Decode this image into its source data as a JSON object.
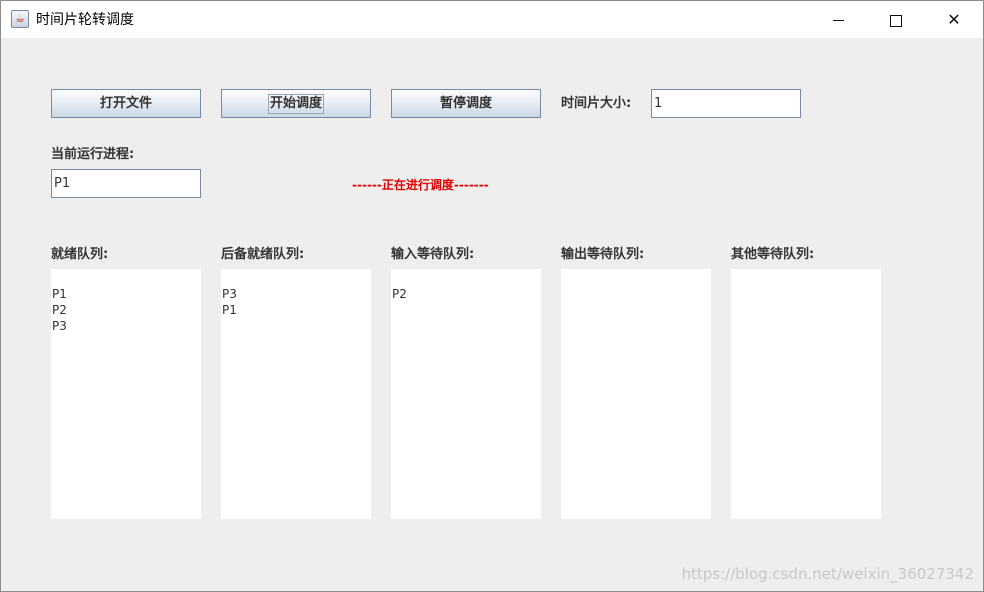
{
  "window": {
    "title": "时间片轮转调度",
    "icon": "java-cup-icon",
    "controls": {
      "minimize": "minimize-icon",
      "maximize": "maximize-icon",
      "close": "✕"
    }
  },
  "toolbar": {
    "open_file_label": "打开文件",
    "start_label": "开始调度",
    "pause_label": "暂停调度",
    "time_slice_label": "时间片大小:",
    "time_slice_value": "1"
  },
  "current": {
    "label": "当前运行进程:",
    "value": "P1"
  },
  "status": {
    "text": "------正在进行调度-------",
    "color": "#e00000"
  },
  "queues": [
    {
      "label": "就绪队列:",
      "items": [
        "P1",
        "P2",
        "P3"
      ]
    },
    {
      "label": "后备就绪队列:",
      "items": [
        "P3",
        "P1"
      ]
    },
    {
      "label": "输入等待队列:",
      "items": [
        "P2"
      ]
    },
    {
      "label": "输出等待队列:",
      "items": []
    },
    {
      "label": "其他等待队列:",
      "items": []
    }
  ],
  "watermark": "https://blog.csdn.net/weixin_36027342"
}
